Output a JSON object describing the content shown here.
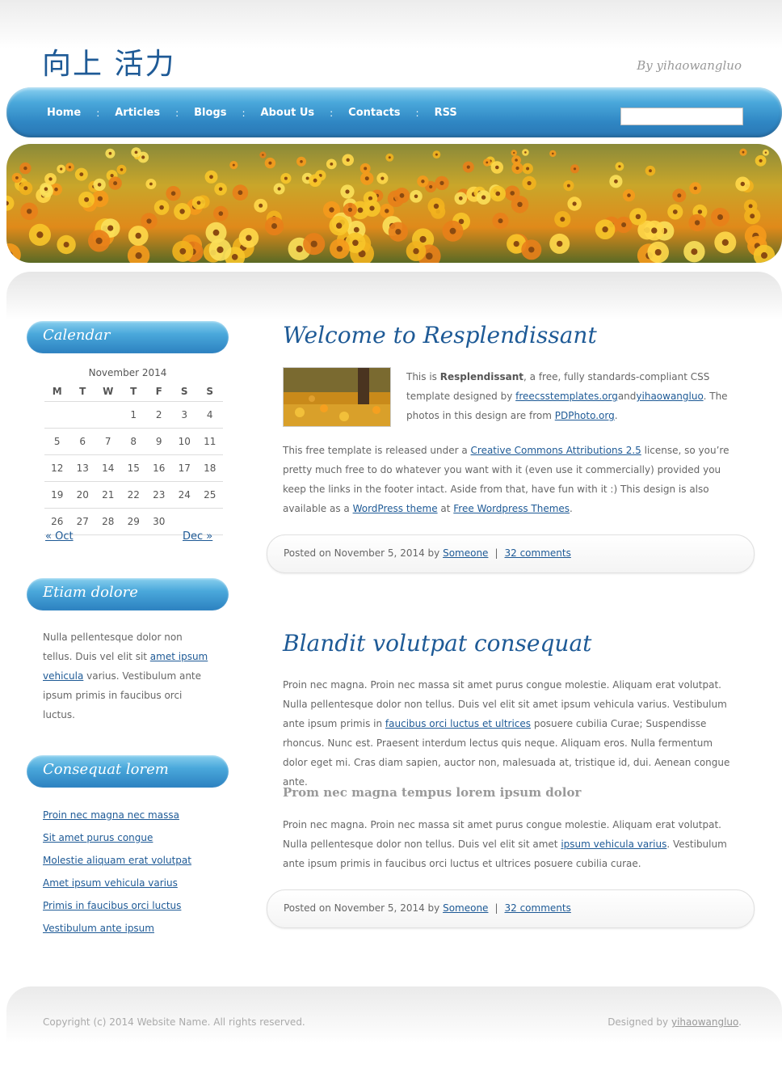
{
  "header": {
    "logo": "向上 活力",
    "byline": "By yihaowangluo"
  },
  "menu": {
    "items": [
      "Home",
      "Articles",
      "Blogs",
      "About Us",
      "Contacts",
      "RSS"
    ],
    "separator": ":",
    "search_placeholder": ""
  },
  "sidebar": {
    "calendar": {
      "title": "Calendar",
      "caption": "November 2014",
      "days": [
        "M",
        "T",
        "W",
        "T",
        "F",
        "S",
        "S"
      ],
      "weeks": [
        [
          "",
          "",
          "",
          "1",
          "2",
          "3",
          "4"
        ],
        [
          "5",
          "6",
          "7",
          "8",
          "9",
          "10",
          "11"
        ],
        [
          "12",
          "13",
          "14",
          "15",
          "16",
          "17",
          "18"
        ],
        [
          "19",
          "20",
          "21",
          "22",
          "23",
          "24",
          "25"
        ],
        [
          "26",
          "27",
          "28",
          "29",
          "30",
          "",
          ""
        ]
      ],
      "prev": "« Oct",
      "next": "Dec »"
    },
    "box2": {
      "title": "Etiam dolore",
      "text_1": "Nulla pellentesque dolor non tellus. Duis vel elit sit ",
      "link": "amet ipsum vehicula",
      "text_2": " varius. Vestibulum ante ipsum primis in faucibus orci luctus."
    },
    "box3": {
      "title": "Consequat lorem",
      "links": [
        "Proin nec magna nec massa",
        "Sit amet purus congue",
        "Molestie aliquam erat volutpat",
        "Amet ipsum vehicula varius",
        "Primis in faucibus orci luctus",
        "Vestibulum ante ipsum"
      ]
    }
  },
  "post1": {
    "title": "Welcome to Resplendissant",
    "p1_a": "This is ",
    "p1_b": "Resplendissant",
    "p1_c": ", a free, fully standards-compliant CSS template designed by ",
    "p1_link1": "freecsstemplates.org",
    "p1_d": "and",
    "p1_link2": "yihaowangluo",
    "p1_e": ". The photos in this design are from ",
    "p1_link3": "PDPhoto.org",
    "p1_f": ".",
    "p2_a": "This free template is released under a ",
    "p2_link1": "Creative Commons Attributions 2.5",
    "p2_b": " license, so you’re pretty much free to do whatever you want with it (even use it commercially) provided you keep the links in the footer intact. Aside from that, have fun with it :) This design is also available as a ",
    "p2_link2": "WordPress theme",
    "p2_c": " at ",
    "p2_link3": "Free Wordpress Themes",
    "p2_d": ".",
    "meta_posted": "Posted on November 5, 2014 by ",
    "meta_author": "Someone",
    "meta_sep": "|",
    "meta_comments": "32 comments"
  },
  "post2": {
    "title": "Blandit volutpat consequat",
    "p1_a": "Proin nec magna. Proin nec massa sit amet purus congue molestie. Aliquam erat volutpat. Nulla pellentesque dolor non tellus. Duis vel elit sit amet ipsum vehicula varius. Vestibulum ante ipsum primis in ",
    "p1_link": "faucibus orci luctus et ultrices",
    "p1_b": " posuere cubilia Curae; Suspendisse rhoncus. Nunc est. Praesent interdum lectus quis neque. Aliquam eros. Nulla fermentum dolor eget mi. Cras diam sapien, auctor non, malesuada at, tristique id, dui. Aenean congue ante.",
    "subhead": "Prom nec magna tempus lorem ipsum dolor",
    "p2_a": "Proin nec magna. Proin nec massa sit amet purus congue molestie. Aliquam erat volutpat. Nulla pellentesque dolor non tellus. Duis vel elit sit amet ",
    "p2_link": "ipsum vehicula varius",
    "p2_b": ". Vestibulum ante ipsum primis in faucibus orci luctus et ultrices posuere cubilia curae.",
    "meta_posted": "Posted on November 5, 2014 by ",
    "meta_author": "Someone",
    "meta_sep": "|",
    "meta_comments": "32 comments"
  },
  "footer": {
    "copyright": "Copyright (c) 2014 Website Name. All rights reserved.",
    "designed_by": "Designed by ",
    "designer": "yihaowangluo",
    "designed_end": "."
  }
}
